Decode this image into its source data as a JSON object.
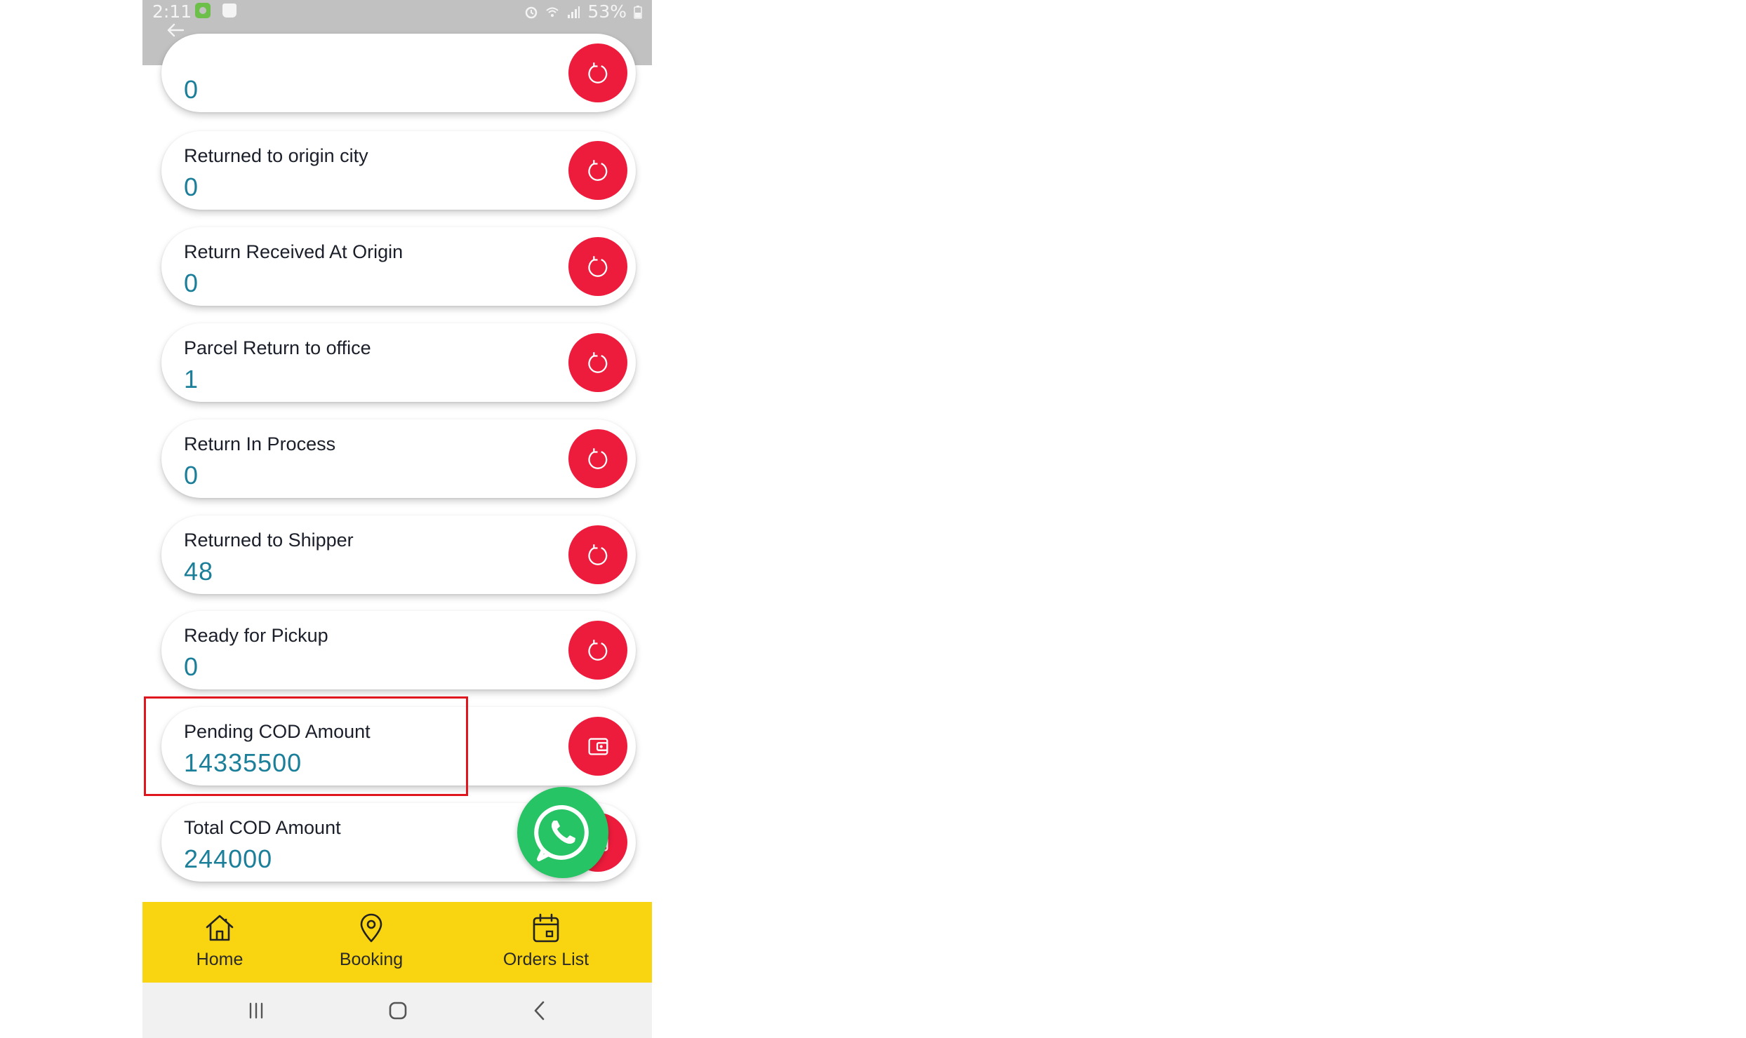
{
  "status_bar": {
    "time": "2:11",
    "battery": "53%"
  },
  "cards": [
    {
      "label": "",
      "value": "0",
      "icon": "refresh-icon"
    },
    {
      "label": "Returned to origin city",
      "value": "0",
      "icon": "refresh-icon"
    },
    {
      "label": "Return Received At Origin",
      "value": "0",
      "icon": "refresh-icon"
    },
    {
      "label": "Parcel Return to office",
      "value": "1",
      "icon": "refresh-icon"
    },
    {
      "label": "Return In Process",
      "value": "0",
      "icon": "refresh-icon"
    },
    {
      "label": "Returned to Shipper",
      "value": "48",
      "icon": "refresh-icon"
    },
    {
      "label": "Ready for Pickup",
      "value": "0",
      "icon": "refresh-icon"
    },
    {
      "label": "Pending COD Amount",
      "value": "14335500",
      "icon": "wallet-icon"
    },
    {
      "label": "Total COD Amount",
      "value": "244000",
      "icon": "wallet-icon"
    }
  ],
  "bottom_nav": {
    "items": [
      {
        "label": "Home",
        "icon": "home-icon"
      },
      {
        "label": "Booking",
        "icon": "location-pin-icon"
      },
      {
        "label": "Orders List",
        "icon": "calendar-icon"
      }
    ]
  },
  "colors": {
    "accent_red": "#ed1c3c",
    "value_teal": "#1b7f9a",
    "nav_yellow": "#f9d511",
    "whatsapp_green": "#26c464",
    "highlight_red": "#e0161e"
  }
}
